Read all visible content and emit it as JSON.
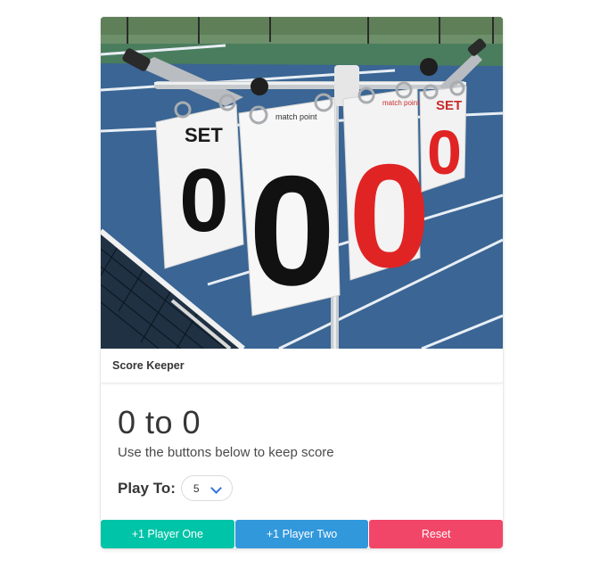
{
  "header": {
    "title": "Score Keeper"
  },
  "score": {
    "display": "0 to 0",
    "instructions": "Use the buttons below to keep score"
  },
  "play_to": {
    "label": "Play To:",
    "selected": "5"
  },
  "buttons": {
    "player_one": "+1 Player One",
    "player_two": "+1 Player Two",
    "reset": "Reset"
  },
  "scoreboard_image": {
    "left_card_label": "SET",
    "left_card_digit": "0",
    "middle_card_digit": "0",
    "middle_card_logo": "match point",
    "red_card_digit": "0",
    "right_card_label": "SET",
    "right_card_digit": "0"
  },
  "colors": {
    "player_one": "#00c4a7",
    "player_two": "#3298dc",
    "reset": "#f14668"
  }
}
